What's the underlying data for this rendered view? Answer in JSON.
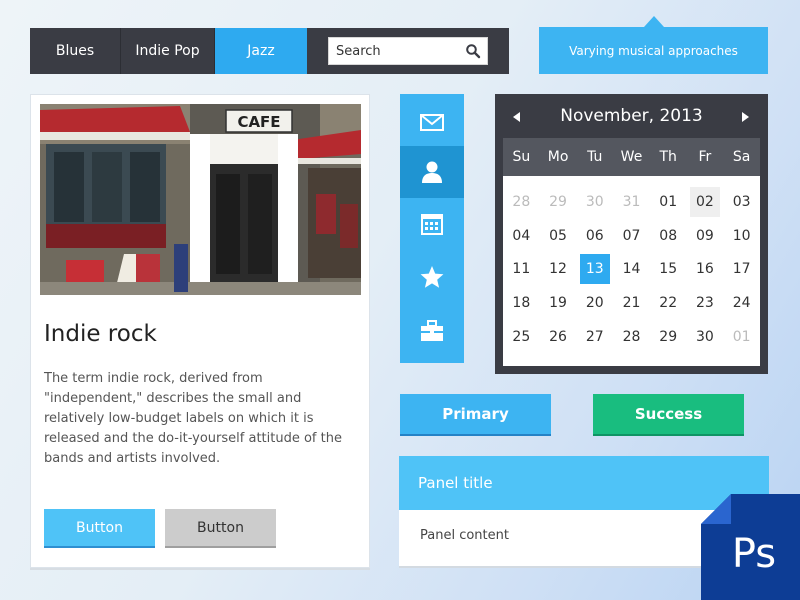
{
  "nav": {
    "tabs": [
      {
        "label": "Blues"
      },
      {
        "label": "Indie Pop"
      },
      {
        "label": "Jazz"
      }
    ],
    "search_placeholder": "Search",
    "search_icon": "search-icon"
  },
  "tooltip": {
    "text": "Varying musical approaches"
  },
  "card": {
    "image_alt": "cafe-storefront-photo",
    "title": "Indie rock",
    "text": "The term indie rock, derived from \"independent,\" describes the small and relatively low-budget labels on which it is released and the do-it-yourself attitude of the bands and artists involved.",
    "button_primary": "Button",
    "button_secondary": "Button",
    "photo_sign": "CAFE"
  },
  "iconbar": {
    "items": [
      {
        "icon": "mail-icon"
      },
      {
        "icon": "user-icon"
      },
      {
        "icon": "calendar-icon"
      },
      {
        "icon": "star-icon"
      },
      {
        "icon": "briefcase-icon"
      }
    ]
  },
  "calendar": {
    "month_label": "November, 2013",
    "weekdays": [
      "Su",
      "Mo",
      "Tu",
      "We",
      "Th",
      "Fr",
      "Sa"
    ],
    "weeks": [
      [
        "28",
        "29",
        "30",
        "31",
        "01",
        "02",
        "03"
      ],
      [
        "04",
        "05",
        "06",
        "07",
        "08",
        "09",
        "10"
      ],
      [
        "11",
        "12",
        "13",
        "14",
        "15",
        "16",
        "17"
      ],
      [
        "18",
        "19",
        "20",
        "21",
        "22",
        "23",
        "24"
      ],
      [
        "25",
        "26",
        "27",
        "28",
        "29",
        "30",
        "01"
      ]
    ],
    "selected": "13",
    "highlighted": "02"
  },
  "buttons": {
    "primary": "Primary",
    "success": "Success"
  },
  "panel": {
    "title": "Panel title",
    "content": "Panel content"
  },
  "badge": {
    "text": "Ps"
  },
  "colors": {
    "accent": "#2eaaf0",
    "light_accent": "#4fc3f7",
    "success": "#19bd7f",
    "dark": "#3a3c44",
    "ps_blue": "#0d3d95"
  }
}
